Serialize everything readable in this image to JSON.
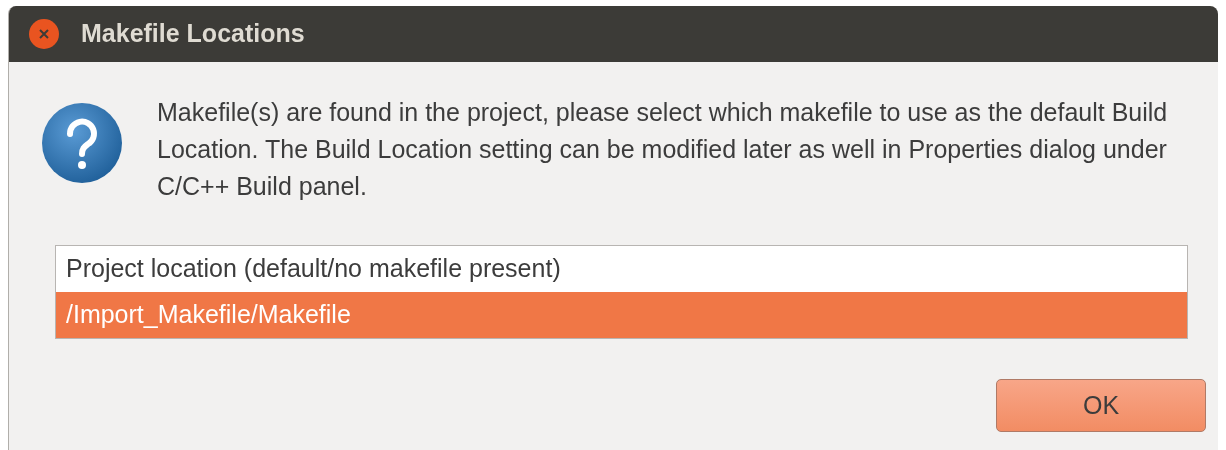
{
  "window": {
    "title": "Makefile Locations"
  },
  "message": "Makefile(s) are found in the project, please select which makefile to use as the default Build Location. The Build Location setting can be modified later as well in Properties dialog under C/C++ Build panel.",
  "locations": [
    {
      "label": "Project location (default/no makefile present)",
      "selected": false
    },
    {
      "label": "/Import_Makefile/Makefile",
      "selected": true
    }
  ],
  "buttons": [
    "OK"
  ]
}
